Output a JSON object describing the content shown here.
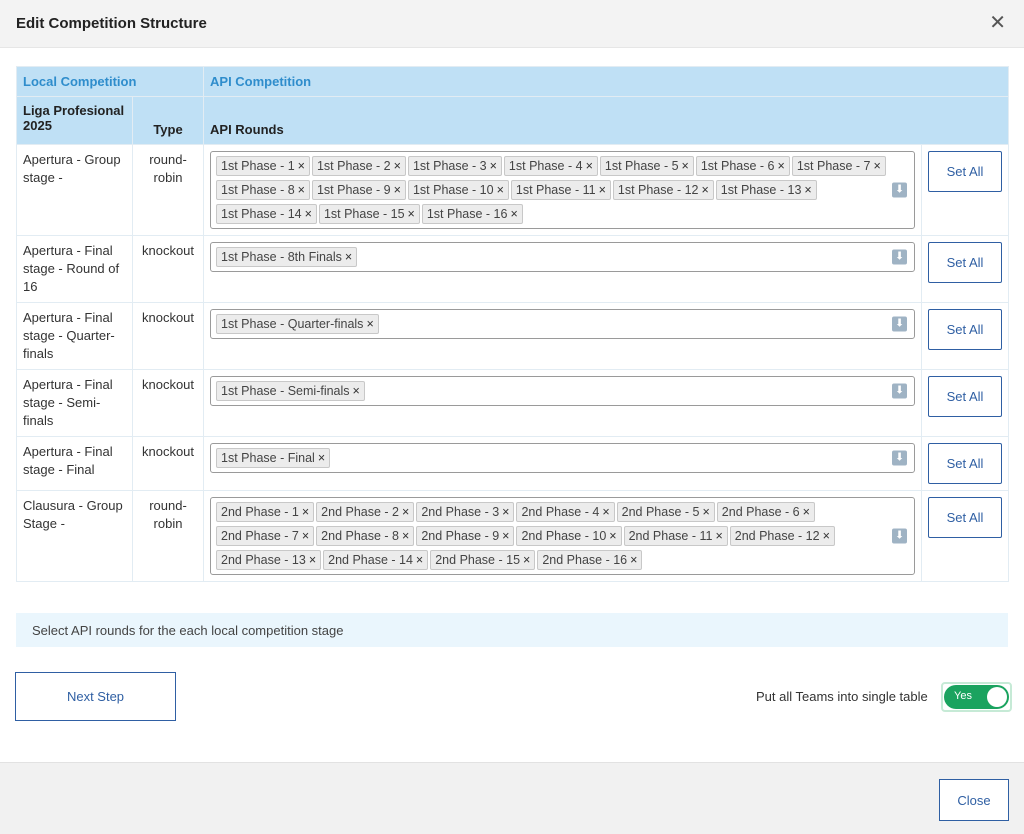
{
  "modal": {
    "title": "Edit Competition Structure",
    "close_icon": "close-icon"
  },
  "table": {
    "header_local": "Local Competition",
    "header_api": "API Competition",
    "sub_competition": "Liga Profesional 2025",
    "sub_type": "Type",
    "sub_rounds": "API Rounds"
  },
  "rows": [
    {
      "stage": "Apertura - Group stage -",
      "type": "round-robin",
      "rounds": [
        "1st Phase - 1",
        "1st Phase - 2",
        "1st Phase - 3",
        "1st Phase - 4",
        "1st Phase - 5",
        "1st Phase - 6",
        "1st Phase - 7",
        "1st Phase - 8",
        "1st Phase - 9",
        "1st Phase - 10",
        "1st Phase - 11",
        "1st Phase - 12",
        "1st Phase - 13",
        "1st Phase - 14",
        "1st Phase - 15",
        "1st Phase - 16"
      ],
      "button": "Set All"
    },
    {
      "stage": "Apertura - Final stage - Round of 16",
      "type": "knockout",
      "rounds": [
        "1st Phase - 8th Finals"
      ],
      "button": "Set All"
    },
    {
      "stage": "Apertura - Final stage - Quarter-finals",
      "type": "knockout",
      "rounds": [
        "1st Phase - Quarter-finals"
      ],
      "button": "Set All"
    },
    {
      "stage": "Apertura - Final stage - Semi-finals",
      "type": "knockout",
      "rounds": [
        "1st Phase - Semi-finals"
      ],
      "button": "Set All"
    },
    {
      "stage": "Apertura - Final stage - Final",
      "type": "knockout",
      "rounds": [
        "1st Phase - Final"
      ],
      "button": "Set All"
    },
    {
      "stage": "Clausura - Group Stage -",
      "type": "round-robin",
      "rounds": [
        "2nd Phase - 1",
        "2nd Phase - 2",
        "2nd Phase - 3",
        "2nd Phase - 4",
        "2nd Phase - 5",
        "2nd Phase - 6",
        "2nd Phase - 7",
        "2nd Phase - 8",
        "2nd Phase - 9",
        "2nd Phase - 10",
        "2nd Phase - 11",
        "2nd Phase - 12",
        "2nd Phase - 13",
        "2nd Phase - 14",
        "2nd Phase - 15",
        "2nd Phase - 16"
      ],
      "button": "Set All"
    }
  ],
  "hint": "Select API rounds for the each local competition stage",
  "next_step": "Next Step",
  "toggle": {
    "label": "Put all Teams into single table",
    "state_text": "Yes",
    "on": true,
    "color": "#1aa35f"
  },
  "footer": {
    "close": "Close"
  },
  "colors": {
    "accent": "#2f5fa3",
    "header_bg": "#bfe0f5",
    "header_text": "#2f8dcc"
  }
}
